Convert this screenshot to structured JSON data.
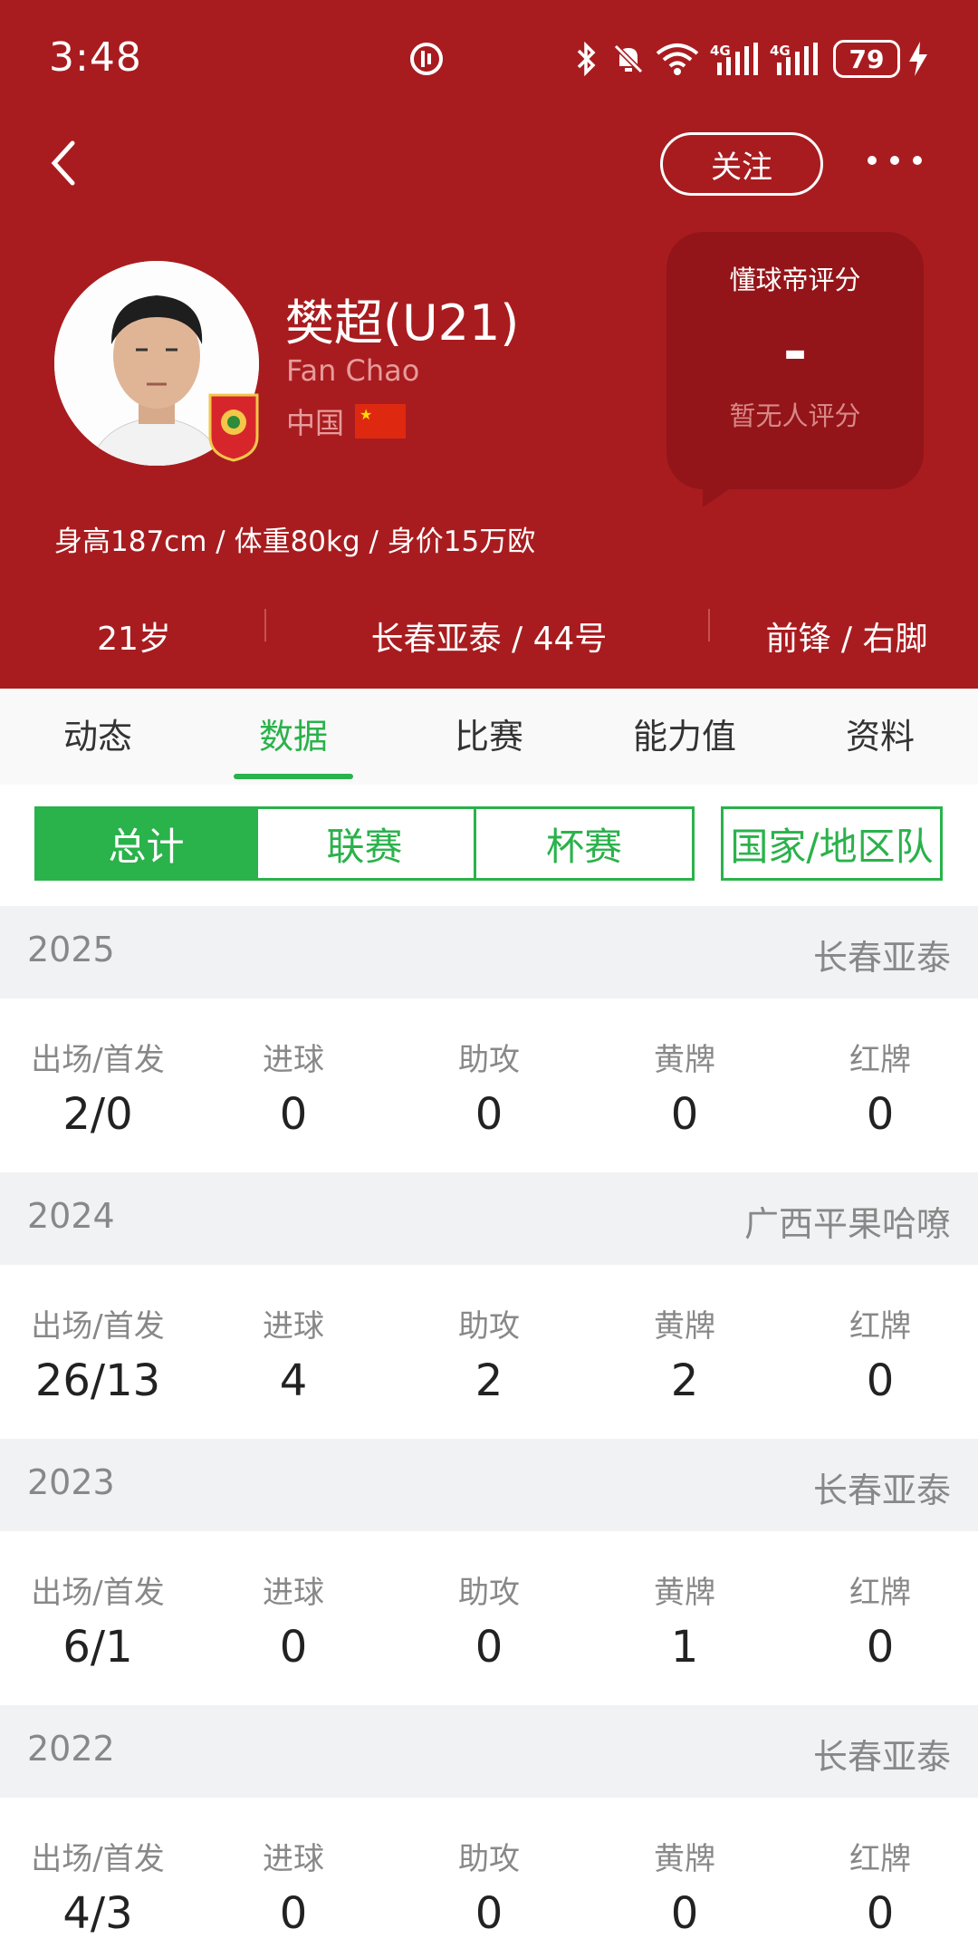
{
  "status_bar": {
    "time": "3:48",
    "battery": "79"
  },
  "nav": {
    "follow_label": "关注"
  },
  "player": {
    "name": "樊超(U21)",
    "name_en": "Fan Chao",
    "country": "中国",
    "stats_line": "身高187cm / 体重80kg / 身价15万欧",
    "age": "21岁",
    "club_number": "长春亚泰 / 44号",
    "position_foot": "前锋 / 右脚"
  },
  "rating": {
    "title": "懂球帝评分",
    "value": "-",
    "subtitle": "暂无人评分"
  },
  "tabs": [
    {
      "label": "动态"
    },
    {
      "label": "数据"
    },
    {
      "label": "比赛"
    },
    {
      "label": "能力值"
    },
    {
      "label": "资料"
    }
  ],
  "active_tab": "数据",
  "segments": [
    {
      "label": "总计"
    },
    {
      "label": "联赛"
    },
    {
      "label": "杯赛"
    },
    {
      "label": "国家/地区队"
    }
  ],
  "stat_labels": [
    "出场/首发",
    "进球",
    "助攻",
    "黄牌",
    "红牌"
  ],
  "seasons": [
    {
      "year": "2025",
      "team": "长春亚泰",
      "values": [
        "2/0",
        "0",
        "0",
        "0",
        "0"
      ]
    },
    {
      "year": "2024",
      "team": "广西平果哈嘹",
      "values": [
        "26/13",
        "4",
        "2",
        "2",
        "0"
      ]
    },
    {
      "year": "2023",
      "team": "长春亚泰",
      "values": [
        "6/1",
        "0",
        "0",
        "1",
        "0"
      ]
    },
    {
      "year": "2022",
      "team": "长春亚泰",
      "values": [
        "4/3",
        "0",
        "0",
        "0",
        "0"
      ]
    }
  ],
  "colors": {
    "header_red": "#a81c1f",
    "rating_card": "#931519",
    "accent_green": "#2ab24b"
  }
}
